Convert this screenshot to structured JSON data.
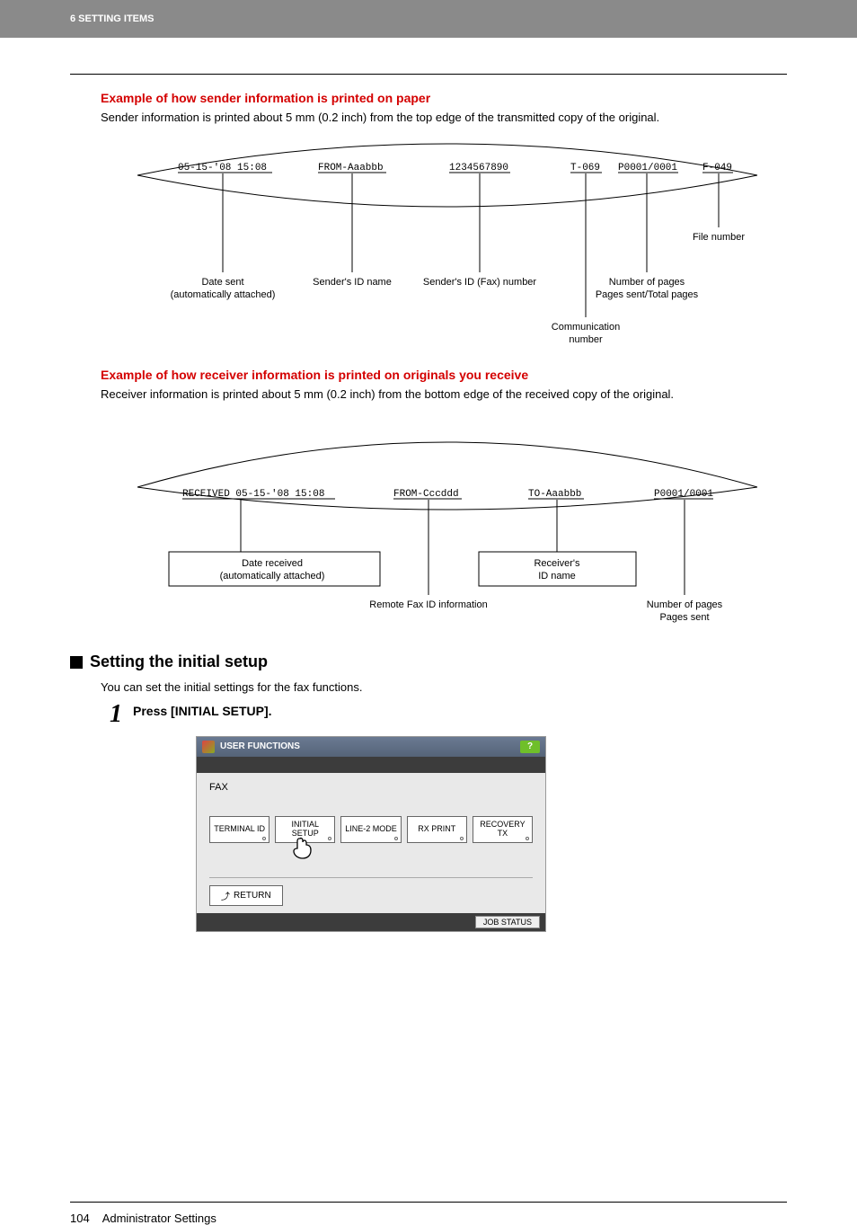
{
  "header": {
    "chapter": "6 SETTING ITEMS"
  },
  "example1": {
    "title": "Example of how sender information is printed on paper",
    "desc": "Sender information is printed about 5 mm (0.2 inch) from the top edge of the transmitted copy of the original.",
    "fields": {
      "date": "05-15-'08 15:08",
      "from": "FROM-Aaabbb",
      "fax": "1234567890",
      "comm": "T-069",
      "pages": "P0001/0001",
      "file": "F-049"
    },
    "labels": {
      "date1": "Date sent",
      "date2": "(automatically attached)",
      "senderId": "Sender's ID name",
      "faxNum": "Sender's ID (Fax) number",
      "comm1": "Communication",
      "comm2": "number",
      "pages1": "Number of pages",
      "pages2": "Pages sent/Total pages",
      "file": "File number"
    }
  },
  "example2": {
    "title": "Example of how receiver information is printed on originals you receive",
    "desc": "Receiver information is printed about 5 mm (0.2 inch) from the bottom edge of the received copy of the original.",
    "fields": {
      "recv": "RECEIVED 05-15-'08 15:08",
      "from": "FROM-Cccddd",
      "to": "TO-Aaabbb",
      "pages": "P0001/0001"
    },
    "labels": {
      "date1": "Date received",
      "date2": "(automatically attached)",
      "remote": "Remote Fax ID information",
      "recv1": "Receiver's",
      "recv2": "ID name",
      "pages1": "Number of pages",
      "pages2": "Pages sent"
    }
  },
  "section": {
    "heading": "Setting the initial setup",
    "intro": "You can set the initial settings for the fax functions.",
    "step1_num": "1",
    "step1_text": "Press [INITIAL SETUP]."
  },
  "ui": {
    "title": "USER FUNCTIONS",
    "help": "?",
    "fax": "FAX",
    "buttons": {
      "b1": "TERMINAL ID",
      "b2a": "INITIAL",
      "b2b": "SETUP",
      "b3": "LINE-2 MODE",
      "b4": "RX PRINT",
      "b5a": "RECOVERY",
      "b5b": "TX"
    },
    "return_arrow": "⤴",
    "return": "RETURN",
    "jobstatus": "JOB STATUS"
  },
  "footer": {
    "page": "104",
    "label": "Administrator Settings"
  }
}
